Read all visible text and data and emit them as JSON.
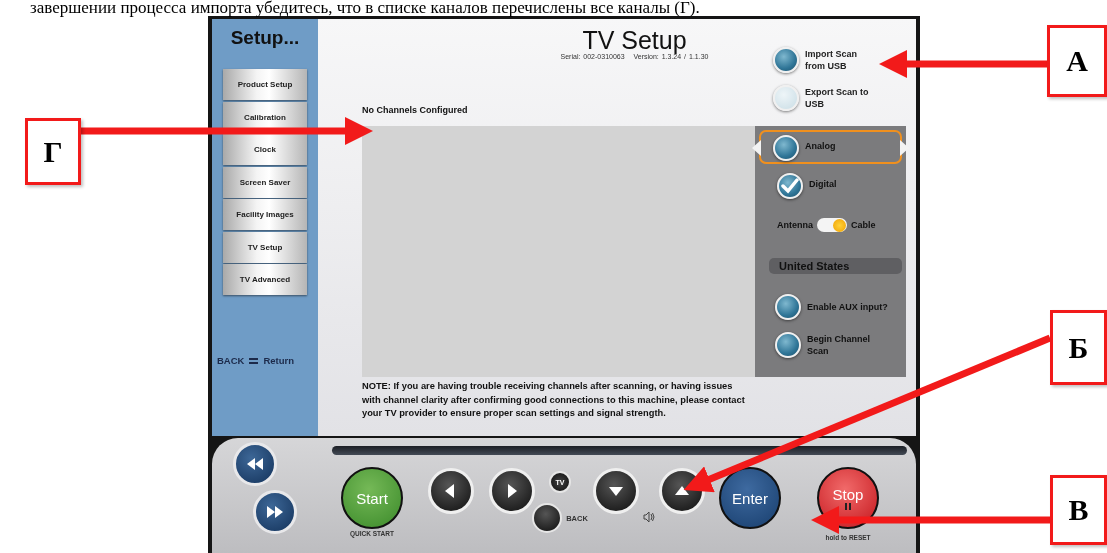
{
  "caption": "завершении процесса импорта убедитесь, что в списке каналов перечислены все каналы (Г).",
  "sidebar": {
    "title": "Setup...",
    "items": [
      {
        "label": "Product Setup"
      },
      {
        "label": "Calibration"
      },
      {
        "label": "Clock"
      },
      {
        "label": "Screen Saver"
      },
      {
        "label": "Facility Images"
      },
      {
        "label": "TV Setup"
      },
      {
        "label": "TV Advanced"
      }
    ],
    "back_key": "BACK",
    "back_action": "Return"
  },
  "header": {
    "title": "TV Setup",
    "serial": "Serial: 002-0310063",
    "version": "Version: 1.3.24 / 1.1.30"
  },
  "top_options": [
    {
      "label": "Import Scan from USB",
      "disabled": false
    },
    {
      "label": "Export Scan to USB",
      "disabled": true
    }
  ],
  "channel_list": {
    "heading": "No Channels Configured"
  },
  "scan_panel": {
    "options": [
      {
        "label": "Analog",
        "checked": false,
        "focused": true
      },
      {
        "label": "Digital",
        "checked": true,
        "focused": false
      }
    ],
    "toggle": {
      "left": "Antenna",
      "right": "Cable",
      "on": true
    },
    "region": "United States",
    "actions": [
      {
        "label": "Enable AUX input?"
      },
      {
        "label": "Begin Channel Scan"
      }
    ]
  },
  "note": "NOTE: If you are having trouble receiving channels after scanning, or having issues with channel clarity after confirming good connections to this machine, please contact your TV provider to ensure proper scan settings and signal strength.",
  "controls": {
    "start": {
      "label": "Start",
      "caption": "QUICK START"
    },
    "tv_key": "TV",
    "back_key": "BACK",
    "enter": "Enter",
    "stop": {
      "label": "Stop",
      "caption": "hold to RESET"
    }
  },
  "annotations": [
    {
      "label": "А"
    },
    {
      "label": "Г"
    },
    {
      "label": "Б"
    },
    {
      "label": "В"
    }
  ]
}
